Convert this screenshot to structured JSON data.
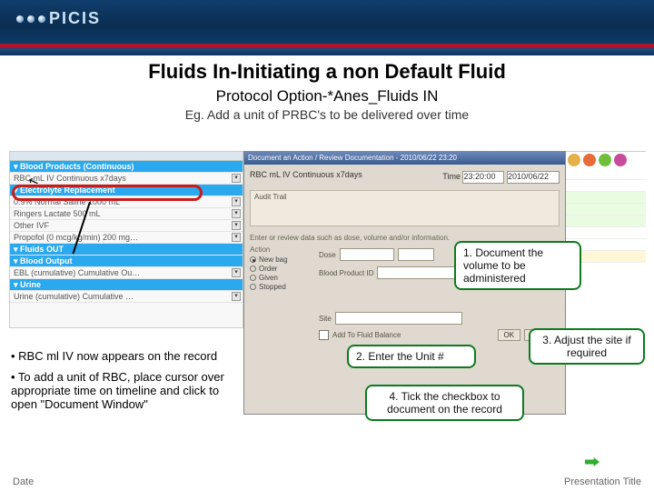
{
  "brand": "PICIS",
  "title": "Fluids In-Initiating a non Default Fluid",
  "subtitle": "Protocol Option-*Anes_Fluids IN",
  "egline": "Eg. Add a unit of PRBC's to be delivered over time",
  "left_rows": {
    "r1": "▾ Blood Products (Continuous)",
    "r2": "RBC  mL  IV  Continuous x7days",
    "r3": "▾ Electrolyte Replacement",
    "r4": "0.9% Normal Saline 1000 mL",
    "r5": "Ringers Lactate 500 mL",
    "r6": "Other IVF",
    "r7": "Propofol (0 mcg/kg/min) 200 mg…",
    "r8": "▾ Fluids OUT",
    "r9": "▾ Blood Output",
    "r10": "EBL (cumulative) Cumulative Ou…",
    "r11": "▾ Urine",
    "r12": "Urine (cumulative) Cumulative …"
  },
  "dialog": {
    "title": "Document an Action / Review Documentation - 2010/06/22 23:20",
    "protocol": "RBC mL IV Continuous x7days",
    "time_label": "Time",
    "time_val": "23:20:00",
    "date_val": "2010/06/22",
    "audit_label": "Audit Trail",
    "info_label": "Enter or review data such as dose, volume and/or information.",
    "action_label": "Action",
    "opt1": "New bag",
    "opt2": "Order",
    "opt3": "Given",
    "opt4": "Stopped",
    "dose_label": "Dose",
    "blood_label": "Blood Product ID",
    "site_label": "Site",
    "addbal": "Add To Fluid Balance",
    "ok": "OK",
    "cancel": "Cancel"
  },
  "callouts": {
    "c1": "1. Document the volume to be administered",
    "c2": "2. Enter the Unit #",
    "c3": "3. Adjust the site if required",
    "c4": "4. Tick the checkbox to document on the record"
  },
  "bullets": {
    "b1": "• RBC ml IV now appears on the record",
    "b2": "• To add a unit of RBC, place cursor over appropriate time on timeline and click to open \"Document Window\""
  },
  "footer": {
    "left": "Date",
    "right": "Presentation Title"
  }
}
